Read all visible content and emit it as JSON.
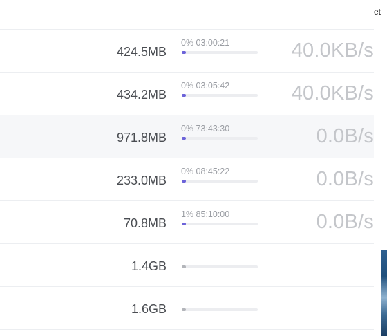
{
  "transfers": [
    {
      "size": "424.5MB",
      "meta": "0% 03:00:21",
      "progress": 0,
      "speed": "40.0KB/s",
      "active": true
    },
    {
      "size": "434.2MB",
      "meta": "0% 03:05:42",
      "progress": 0,
      "speed": "40.0KB/s",
      "active": true
    },
    {
      "size": "971.8MB",
      "meta": "0% 73:43:30",
      "progress": 0,
      "speed": "0.0B/s",
      "active": true
    },
    {
      "size": "233.0MB",
      "meta": "0% 08:45:22",
      "progress": 0,
      "speed": "0.0B/s",
      "active": true
    },
    {
      "size": "70.8MB",
      "meta": "1% 85:10:00",
      "progress": 1,
      "speed": "0.0B/s",
      "active": true
    },
    {
      "size": "1.4GB",
      "meta": "",
      "progress": 0,
      "speed": "",
      "active": false
    },
    {
      "size": "1.6GB",
      "meta": "",
      "progress": 0,
      "speed": "",
      "active": false
    }
  ],
  "colors": {
    "accent": "#6c63d9",
    "inactive_bar": "#b3b5ba",
    "highlight_row": "#f6f7f9"
  },
  "edge_window": {
    "text": "et"
  }
}
